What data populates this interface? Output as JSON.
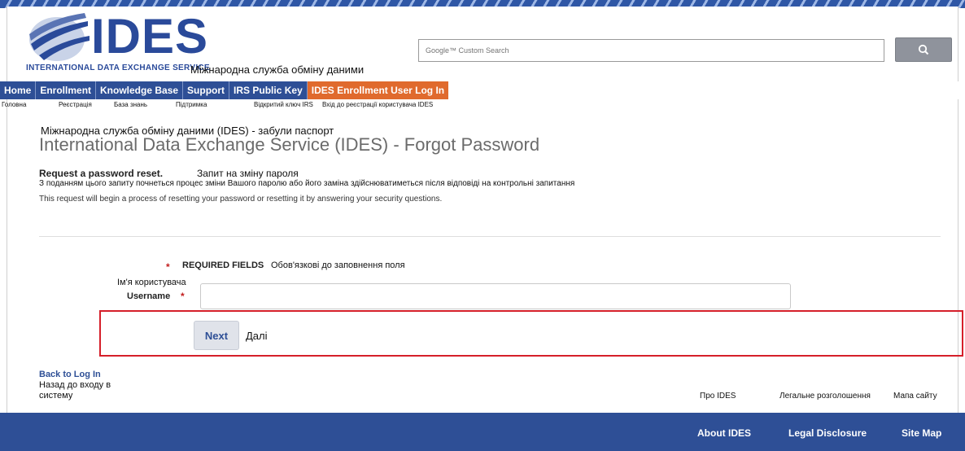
{
  "header": {
    "logo_text": "IDES",
    "logo_subtitle": "INTERNATIONAL DATA EXCHANGE SERVICE",
    "logo_ua": "Міжнародна служба обміну даними",
    "search_placeholder": "Google™ Custom Search",
    "search_icon": "search-icon"
  },
  "nav": {
    "items": [
      {
        "label": "Home",
        "ua": "Головна"
      },
      {
        "label": "Enrollment",
        "ua": "Реєстрація"
      },
      {
        "label": "Knowledge Base",
        "ua": "База знань"
      },
      {
        "label": "Support",
        "ua": "Підтримка"
      },
      {
        "label": "IRS Public Key",
        "ua": "Відкритий ключ IRS"
      },
      {
        "label": "IDES Enrollment User Log In",
        "ua": "Вхід до реєстрації користувача IDES"
      }
    ],
    "active_color": "#e06a2d",
    "bar_color": "#2e4f96"
  },
  "page": {
    "title_ua": "Міжнародна служба обміну даними (IDES) - забули паспорт",
    "title": "International Data Exchange Service (IDES) - Forgot Password",
    "request_title": "Request a password reset.",
    "request_title_ua": "Запит на зміну пароля",
    "request_desc_ua": "З поданням цього запиту почнеться процес зміни Вашого паролю або його заміна здійснюватиметься після відповіді на контрольні запитання",
    "request_desc": "This request will begin a process of resetting your password or resetting it by answering your security questions."
  },
  "form": {
    "required_star": "*",
    "required_label": "REQUIRED FIELDS",
    "required_ua": "Обов'язкові до заповнення поля",
    "username_ua": "Ім'я користувача",
    "username_label": "Username",
    "username_star": "*",
    "username_value": "",
    "next_label": "Next",
    "next_ua": "Далі"
  },
  "back": {
    "label": "Back to Log In",
    "ua": "Назад до входу в систему"
  },
  "footer": {
    "links": [
      {
        "label": "About IDES",
        "ua": "Про IDES"
      },
      {
        "label": "Legal Disclosure",
        "ua": "Легальне розголошення"
      },
      {
        "label": "Site Map",
        "ua": "Мапа сайту"
      }
    ],
    "bar_color": "#2e4f96"
  }
}
